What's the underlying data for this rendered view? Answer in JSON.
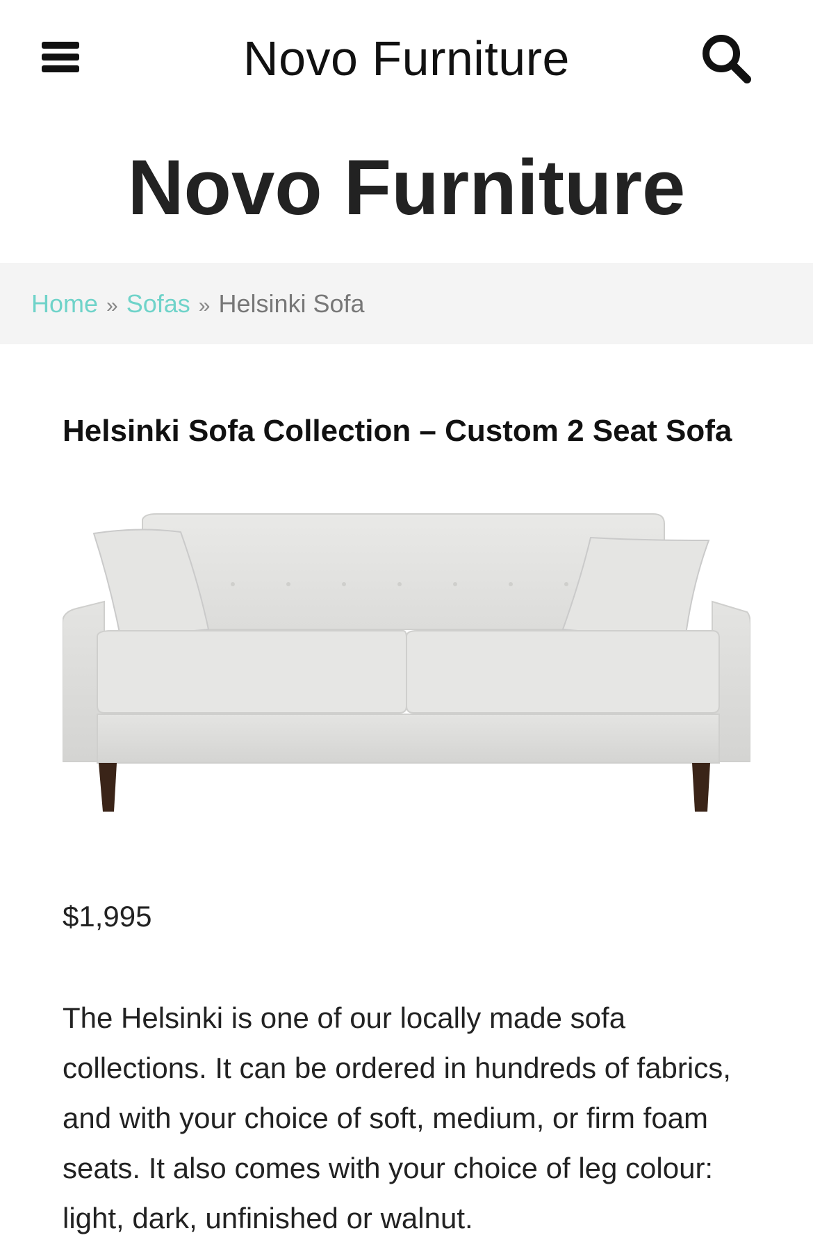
{
  "header": {
    "top_title": "Novo Furniture",
    "menu_icon": "menu-icon",
    "search_icon": "search-icon"
  },
  "site": {
    "title": "Novo Furniture"
  },
  "breadcrumb": {
    "home": "Home",
    "sofas": "Sofas",
    "separator": "»",
    "current": "Helsinki Sofa"
  },
  "product": {
    "title": "Helsinki Sofa Collection – Custom 2 Seat Sofa",
    "price": "$1,995",
    "description": "The Helsinki is one of our locally made sofa collections. It can be ordered in hundreds of fabrics, and with your choice of soft, medium, or firm foam seats. It also comes with your choice of leg colour: light, dark, unfinished or walnut."
  },
  "colors": {
    "link": "#6fd3c9",
    "breadcrumb_bg": "#f4f4f4",
    "text": "#222222"
  }
}
